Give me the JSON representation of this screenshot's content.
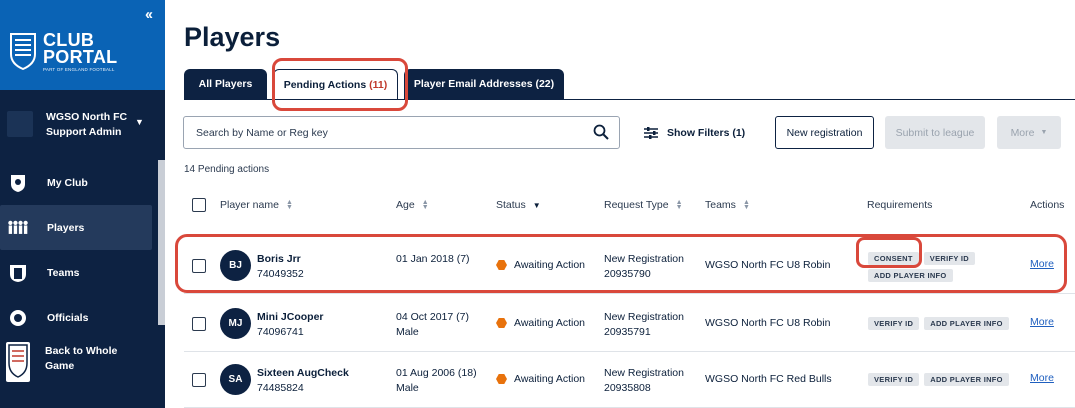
{
  "sidebar": {
    "collapse_icon": "chevrons-left-icon",
    "brand_title_line1": "CLUB",
    "brand_title_line2": "PORTAL",
    "brand_sub": "PART OF ENGLAND FOOTBALL",
    "club_name": "WGSO North FC",
    "club_role": "Support Admin",
    "nav": [
      {
        "label": "My Club",
        "icon": "shield-icon",
        "active": false
      },
      {
        "label": "Players",
        "icon": "players-icon",
        "active": true
      },
      {
        "label": "Teams",
        "icon": "team-shirt-icon",
        "active": false
      },
      {
        "label": "Officials",
        "icon": "official-icon",
        "active": false
      }
    ],
    "back_label": "Back to Whole Game"
  },
  "main": {
    "title": "Players",
    "tabs": [
      {
        "label": "All Players",
        "count": ""
      },
      {
        "label": "Pending Actions",
        "count": "(11)"
      },
      {
        "label": "Player Email Addresses (22)",
        "count": ""
      }
    ],
    "search_placeholder": "Search by Name or Reg key",
    "show_filters": "Show Filters (1)",
    "new_registration": "New registration",
    "submit_to_league": "Submit to league",
    "more_button": "More",
    "pending_count": "14 Pending actions",
    "columns": {
      "player_name": "Player name",
      "age": "Age",
      "status": "Status",
      "request_type": "Request Type",
      "teams": "Teams",
      "requirements": "Requirements",
      "actions": "Actions"
    },
    "rows": [
      {
        "initials": "BJ",
        "name": "Boris Jrr",
        "reg": "74049352",
        "age_line1": "01 Jan 2018 (7)",
        "age_line2": "",
        "status": "Awaiting Action",
        "request_line1": "New Registration",
        "request_line2": "20935790",
        "team": "WGSO North FC U8 Robin",
        "requirements": [
          "CONSENT",
          "VERIFY ID",
          "ADD PLAYER INFO"
        ],
        "action": "More"
      },
      {
        "initials": "MJ",
        "name": "Mini JCooper",
        "reg": "74096741",
        "age_line1": "04 Oct 2017 (7)",
        "age_line2": "Male",
        "status": "Awaiting Action",
        "request_line1": "New Registration",
        "request_line2": "20935791",
        "team": "WGSO North FC U8 Robin",
        "requirements": [
          "VERIFY ID",
          "ADD PLAYER INFO"
        ],
        "action": "More"
      },
      {
        "initials": "SA",
        "name": "Sixteen AugCheck",
        "reg": "74485824",
        "age_line1": "01 Aug 2006 (18)",
        "age_line2": "Male",
        "status": "Awaiting Action",
        "request_line1": "New Registration",
        "request_line2": "20935808",
        "team": "WGSO North FC Red Bulls",
        "requirements": [
          "VERIFY ID",
          "ADD PLAYER INFO"
        ],
        "action": "More"
      }
    ]
  },
  "colors": {
    "sidebar": "#0d2242",
    "brand": "#0a63b5",
    "highlight": "#d9483b",
    "status": "#e8720c",
    "link": "#1f5fbf"
  }
}
